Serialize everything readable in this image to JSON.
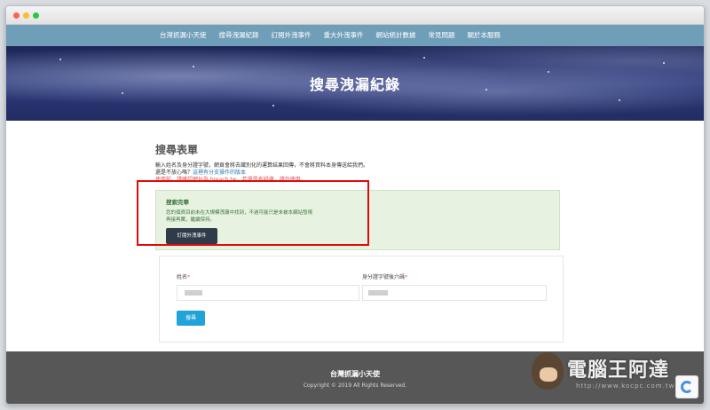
{
  "nav": {
    "items": [
      "台灣抓漏小天使",
      "搜尋洩漏紀錄",
      "訂閱外洩事件",
      "重大外洩事件",
      "網站統計數據",
      "常見問題",
      "關於本服務"
    ]
  },
  "hero": {
    "title": "搜尋洩漏紀錄"
  },
  "form": {
    "title": "搜尋表單",
    "desc_line1": "輸入姓名及身分證字號，網頁會將去識別化的運算結果回傳，不會將資料本身傳送給我們。",
    "desc_line2_prefix": "還是不放心嗎？",
    "desc_line2_link": "這裡有分支操作的版本",
    "desc_line3": "使用前，請確認網址為 breach.tw，若還是有疑慮，請勿使用。"
  },
  "alert": {
    "title": "搜索完畢",
    "text_line1": "您的個資目前未在大規模洩漏中找到，不過可能只是未被本網站發現",
    "text_line2": "再接再厲，繼續保持。",
    "button_label": "訂閱外洩事件"
  },
  "fields": {
    "name_label": "姓名",
    "id_label": "身分證字號後六碼",
    "required_mark": "*"
  },
  "search_button": "搜尋",
  "footer": {
    "title": "台灣抓漏小天使",
    "copyright": "Copyright © 2019 All Rights Reserved."
  },
  "watermark": {
    "text": "電腦王阿達",
    "url": "http://www.kocpc.com.tw"
  },
  "colors": {
    "navbar": "#6f9fb8",
    "alert_bg": "#e8f2e1",
    "alert_text": "#3c763d",
    "dark_button": "#2f3b48",
    "search_button": "#1fa3d9",
    "highlight_border": "#e10a0a",
    "footer": "#575757"
  }
}
